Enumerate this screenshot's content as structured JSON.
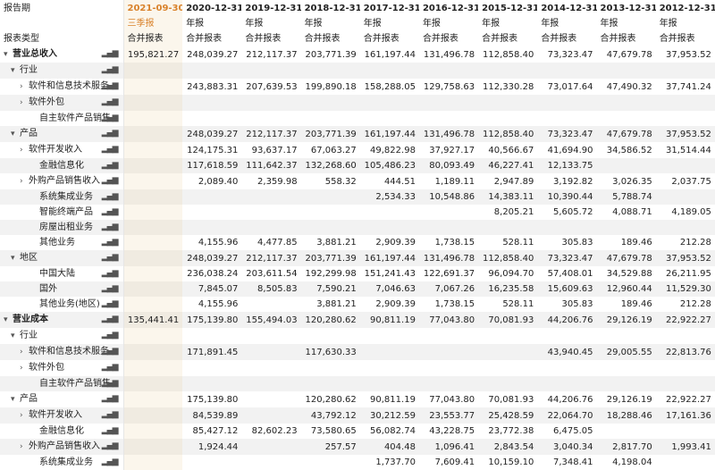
{
  "header": {
    "period_label": "报告期",
    "type_label": "报表类型",
    "dates": [
      "2021-09-30",
      "2020-12-31",
      "2019-12-31",
      "2018-12-31",
      "2017-12-31",
      "2016-12-31",
      "2015-12-31",
      "2014-12-31",
      "2013-12-31",
      "2012-12-31"
    ],
    "periods": [
      "三季报",
      "年报",
      "年报",
      "年报",
      "年报",
      "年报",
      "年报",
      "年报",
      "年报",
      "年报"
    ],
    "types": [
      "合并报表",
      "合并报表",
      "合并报表",
      "合并报表",
      "合并报表",
      "合并报表",
      "合并报表",
      "合并报表",
      "合并报表",
      "合并报表"
    ]
  },
  "chart_icon": "bar-chart-icon",
  "rows": [
    {
      "label": "营业总收入",
      "level": 0,
      "caret": "▾",
      "values": [
        "195,821.27",
        "248,039.27",
        "212,117.37",
        "203,771.39",
        "161,197.44",
        "131,496.78",
        "112,858.40",
        "73,323.47",
        "47,679.78",
        "37,953.52"
      ]
    },
    {
      "label": "行业",
      "level": 1,
      "caret": "▾",
      "values": [
        "",
        "",
        "",
        "",
        "",
        "",
        "",
        "",
        "",
        ""
      ]
    },
    {
      "label": "软件和信息技术服务",
      "level": 2,
      "caret": "›",
      "values": [
        "",
        "243,883.31",
        "207,639.53",
        "199,890.18",
        "158,288.05",
        "129,758.63",
        "112,330.28",
        "73,017.64",
        "47,490.32",
        "37,741.24"
      ]
    },
    {
      "label": "软件外包",
      "level": 2,
      "caret": "›",
      "values": [
        "",
        "",
        "",
        "",
        "",
        "",
        "",
        "",
        "",
        ""
      ]
    },
    {
      "label": "自主软件产品销售",
      "level": 3,
      "caret": "",
      "values": [
        "",
        "",
        "",
        "",
        "",
        "",
        "",
        "",
        "",
        ""
      ]
    },
    {
      "label": "产品",
      "level": 1,
      "caret": "▾",
      "values": [
        "",
        "248,039.27",
        "212,117.37",
        "203,771.39",
        "161,197.44",
        "131,496.78",
        "112,858.40",
        "73,323.47",
        "47,679.78",
        "37,953.52"
      ]
    },
    {
      "label": "软件开发收入",
      "level": 2,
      "caret": "›",
      "values": [
        "",
        "124,175.31",
        "93,637.17",
        "67,063.27",
        "49,822.98",
        "37,927.17",
        "40,566.67",
        "41,694.90",
        "34,586.52",
        "31,514.44"
      ]
    },
    {
      "label": "金融信息化",
      "level": 3,
      "caret": "",
      "values": [
        "",
        "117,618.59",
        "111,642.37",
        "132,268.60",
        "105,486.23",
        "80,093.49",
        "46,227.41",
        "12,133.75",
        "",
        ""
      ]
    },
    {
      "label": "外购产品销售收入",
      "level": 2,
      "caret": "›",
      "values": [
        "",
        "2,089.40",
        "2,359.98",
        "558.32",
        "444.51",
        "1,189.11",
        "2,947.89",
        "3,192.82",
        "3,026.35",
        "2,037.75"
      ]
    },
    {
      "label": "系统集成业务",
      "level": 3,
      "caret": "",
      "values": [
        "",
        "",
        "",
        "",
        "2,534.33",
        "10,548.86",
        "14,383.11",
        "10,390.44",
        "5,788.74",
        ""
      ]
    },
    {
      "label": "智能终端产品",
      "level": 3,
      "caret": "",
      "values": [
        "",
        "",
        "",
        "",
        "",
        "",
        "8,205.21",
        "5,605.72",
        "4,088.71",
        "4,189.05"
      ]
    },
    {
      "label": "房屋出租业务",
      "level": 3,
      "caret": "",
      "values": [
        "",
        "",
        "",
        "",
        "",
        "",
        "",
        "",
        "",
        ""
      ]
    },
    {
      "label": "其他业务",
      "level": 3,
      "caret": "",
      "values": [
        "",
        "4,155.96",
        "4,477.85",
        "3,881.21",
        "2,909.39",
        "1,738.15",
        "528.11",
        "305.83",
        "189.46",
        "212.28"
      ]
    },
    {
      "label": "地区",
      "level": 1,
      "caret": "▾",
      "values": [
        "",
        "248,039.27",
        "212,117.37",
        "203,771.39",
        "161,197.44",
        "131,496.78",
        "112,858.40",
        "73,323.47",
        "47,679.78",
        "37,953.52"
      ]
    },
    {
      "label": "中国大陆",
      "level": 3,
      "caret": "",
      "values": [
        "",
        "236,038.24",
        "203,611.54",
        "192,299.98",
        "151,241.43",
        "122,691.37",
        "96,094.70",
        "57,408.01",
        "34,529.88",
        "26,211.95"
      ]
    },
    {
      "label": "国外",
      "level": 3,
      "caret": "",
      "values": [
        "",
        "7,845.07",
        "8,505.83",
        "7,590.21",
        "7,046.63",
        "7,067.26",
        "16,235.58",
        "15,609.63",
        "12,960.44",
        "11,529.30"
      ]
    },
    {
      "label": "其他业务(地区)",
      "level": 3,
      "caret": "",
      "values": [
        "",
        "4,155.96",
        "",
        "3,881.21",
        "2,909.39",
        "1,738.15",
        "528.11",
        "305.83",
        "189.46",
        "212.28"
      ]
    },
    {
      "label": "营业成本",
      "level": 0,
      "caret": "▾",
      "values": [
        "135,441.41",
        "175,139.80",
        "155,494.03",
        "120,280.62",
        "90,811.19",
        "77,043.80",
        "70,081.93",
        "44,206.76",
        "29,126.19",
        "22,922.27"
      ]
    },
    {
      "label": "行业",
      "level": 1,
      "caret": "▾",
      "values": [
        "",
        "",
        "",
        "",
        "",
        "",
        "",
        "",
        "",
        ""
      ]
    },
    {
      "label": "软件和信息技术服务",
      "level": 2,
      "caret": "›",
      "values": [
        "",
        "171,891.45",
        "",
        "117,630.33",
        "",
        "",
        "",
        "43,940.45",
        "29,005.55",
        "22,813.76"
      ]
    },
    {
      "label": "软件外包",
      "level": 2,
      "caret": "›",
      "values": [
        "",
        "",
        "",
        "",
        "",
        "",
        "",
        "",
        "",
        ""
      ]
    },
    {
      "label": "自主软件产品销售",
      "level": 3,
      "caret": "",
      "values": [
        "",
        "",
        "",
        "",
        "",
        "",
        "",
        "",
        "",
        ""
      ]
    },
    {
      "label": "产品",
      "level": 1,
      "caret": "▾",
      "values": [
        "",
        "175,139.80",
        "",
        "120,280.62",
        "90,811.19",
        "77,043.80",
        "70,081.93",
        "44,206.76",
        "29,126.19",
        "22,922.27"
      ]
    },
    {
      "label": "软件开发收入",
      "level": 2,
      "caret": "›",
      "values": [
        "",
        "84,539.89",
        "",
        "43,792.12",
        "30,212.59",
        "23,553.77",
        "25,428.59",
        "22,064.70",
        "18,288.46",
        "17,161.36"
      ]
    },
    {
      "label": "金融信息化",
      "level": 3,
      "caret": "",
      "values": [
        "",
        "85,427.12",
        "82,602.23",
        "73,580.65",
        "56,082.74",
        "43,228.75",
        "23,772.38",
        "6,475.05",
        "",
        ""
      ]
    },
    {
      "label": "外购产品销售收入",
      "level": 2,
      "caret": "›",
      "values": [
        "",
        "1,924.44",
        "",
        "257.57",
        "404.48",
        "1,096.41",
        "2,843.54",
        "3,040.34",
        "2,817.70",
        "1,993.41"
      ]
    },
    {
      "label": "系统集成业务",
      "level": 3,
      "caret": "",
      "values": [
        "",
        "",
        "",
        "",
        "1,737.70",
        "7,609.41",
        "10,159.10",
        "7,348.41",
        "4,198.04",
        ""
      ]
    }
  ]
}
